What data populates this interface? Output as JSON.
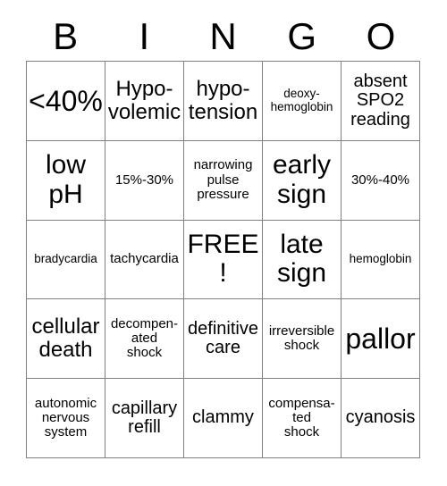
{
  "card": {
    "header_letters": [
      "B",
      "I",
      "N",
      "G",
      "O"
    ],
    "rows": [
      [
        {
          "text": "<40%",
          "size": "fs-xxl"
        },
        {
          "text": "Hypo-\nvolemic",
          "size": "fs-lg"
        },
        {
          "text": "hypo-\ntension",
          "size": "fs-lg"
        },
        {
          "text": "deoxy-\nhemoglobin",
          "size": "fs-xs"
        },
        {
          "text": "absent\nSPO2\nreading",
          "size": "fs-md"
        }
      ],
      [
        {
          "text": "low\npH",
          "size": "fs-xl"
        },
        {
          "text": "15%-30%",
          "size": "fs-sm"
        },
        {
          "text": "narrowing\npulse\npressure",
          "size": "fs-sm"
        },
        {
          "text": "early\nsign",
          "size": "fs-xl"
        },
        {
          "text": "30%-40%",
          "size": "fs-sm"
        }
      ],
      [
        {
          "text": "bradycardia",
          "size": "fs-xs"
        },
        {
          "text": "tachycardia",
          "size": "fs-sm"
        },
        {
          "text": "FREE!",
          "size": "fs-xl"
        },
        {
          "text": "late\nsign",
          "size": "fs-xl"
        },
        {
          "text": "hemoglobin",
          "size": "fs-xs"
        }
      ],
      [
        {
          "text": "cellular\ndeath",
          "size": "fs-lg"
        },
        {
          "text": "decompen-\nated\nshock",
          "size": "fs-sm"
        },
        {
          "text": "definitive\ncare",
          "size": "fs-md"
        },
        {
          "text": "irreversible\nshock",
          "size": "fs-sm"
        },
        {
          "text": "pallor",
          "size": "fs-xxl"
        }
      ],
      [
        {
          "text": "autonomic\nnervous\nsystem",
          "size": "fs-sm"
        },
        {
          "text": "capillary\nrefill",
          "size": "fs-md"
        },
        {
          "text": "clammy",
          "size": "fs-md"
        },
        {
          "text": "compensa-\nted\nshock",
          "size": "fs-sm"
        },
        {
          "text": "cyanosis",
          "size": "fs-md"
        }
      ]
    ],
    "colors": {
      "background": "#ffffff",
      "text": "#000000",
      "grid_line": "#808080"
    }
  }
}
